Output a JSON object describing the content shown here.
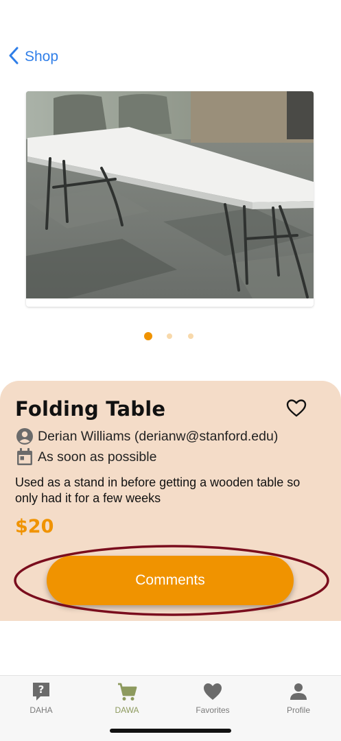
{
  "nav": {
    "back_label": "Shop"
  },
  "item": {
    "title": "Folding Table",
    "seller": "Derian Williams (derianw@stanford.edu)",
    "availability": "As soon as possible",
    "description": "Used as a stand in before getting a wooden table so only had it for a few weeks",
    "price": "$20",
    "image": "folding-table-photo"
  },
  "carousel": {
    "count": 3,
    "active_index": 0
  },
  "comments_button": {
    "label": "Comments"
  },
  "tabs": [
    {
      "label": "DAHA",
      "icon": "question-bubble-icon"
    },
    {
      "label": "DAWA",
      "icon": "cart-icon"
    },
    {
      "label": "Favorites",
      "icon": "heart-icon"
    },
    {
      "label": "Profile",
      "icon": "person-icon"
    }
  ],
  "active_tab": "DAWA",
  "colors": {
    "accent": "#f09300",
    "card_bg": "#f4dcc8",
    "link": "#2f7ee8",
    "active_tab": "#8d9a5e",
    "highlight_ring": "#7a0d1d"
  }
}
